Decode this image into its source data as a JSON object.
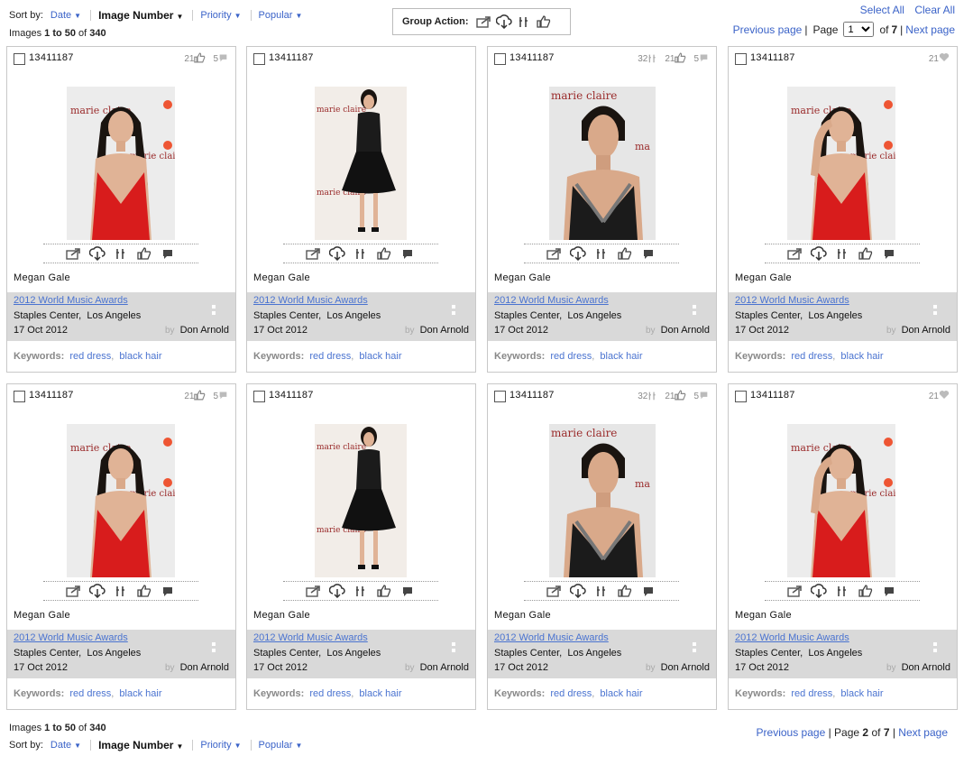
{
  "sort": {
    "label": "Sort by:",
    "options": [
      {
        "label": "Date",
        "active": false
      },
      {
        "label": "Image Number",
        "active": true
      },
      {
        "label": "Priority",
        "active": false
      },
      {
        "label": "Popular",
        "active": false
      }
    ]
  },
  "count": {
    "prefix": "Images ",
    "range": "1 to 50",
    "of": " of ",
    "total": "340"
  },
  "group_action": {
    "label": "Group Action:",
    "icons": [
      "share-icon",
      "download-icon",
      "pin-icon",
      "thumbs-up-icon"
    ]
  },
  "selection": {
    "select_all": "Select All",
    "clear_all": "Clear All"
  },
  "pager_top": {
    "prev": "Previous page",
    "page_label": "Page",
    "page_value": "1",
    "of_label": "of",
    "total_pages": "7",
    "next": "Next page"
  },
  "pager_bottom": {
    "prev": "Previous page",
    "page_label": "Page",
    "page_current": "2",
    "of_label": "of",
    "total_pages": "7",
    "next": "Next page"
  },
  "cards": [
    {
      "id": "13411187",
      "stats": [
        {
          "n": "21",
          "icon": "thumbs-up-icon"
        },
        {
          "n": "5",
          "icon": "comment-icon"
        }
      ],
      "name": "Megan Gale",
      "event": "2012 World Music Awards",
      "venue": "Staples Center,",
      "city": "Los Angeles",
      "date": "17 Oct 2012",
      "by": "by",
      "photographer": "Don Arnold",
      "keywords_label": "Keywords:",
      "keywords": [
        "red dress",
        "black hair"
      ],
      "photo": "red"
    },
    {
      "id": "13411187",
      "stats": [],
      "name": "Megan Gale",
      "event": "2012 World Music Awards",
      "venue": "Staples Center,",
      "city": "Los Angeles",
      "date": "17 Oct 2012",
      "by": "by",
      "photographer": "Don Arnold",
      "keywords_label": "Keywords:",
      "keywords": [
        "red dress",
        "black hair"
      ],
      "photo": "black-full"
    },
    {
      "id": "13411187",
      "stats": [
        {
          "n": "32",
          "icon": "pin-icon"
        },
        {
          "n": "21",
          "icon": "thumbs-up-icon"
        },
        {
          "n": "5",
          "icon": "comment-icon"
        }
      ],
      "name": "Megan Gale",
      "event": "2012 World Music Awards",
      "venue": "Staples Center,",
      "city": "Los Angeles",
      "date": "17 Oct 2012",
      "by": "by",
      "photographer": "Don Arnold",
      "keywords_label": "Keywords:",
      "keywords": [
        "red dress",
        "black hair"
      ],
      "photo": "black-close"
    },
    {
      "id": "13411187",
      "stats": [
        {
          "n": "21",
          "icon": "heart-icon"
        }
      ],
      "name": "Megan Gale",
      "event": "2012 World Music Awards",
      "venue": "Staples Center,",
      "city": "Los Angeles",
      "date": "17 Oct 2012",
      "by": "by",
      "photographer": "Don Arnold",
      "keywords_label": "Keywords:",
      "keywords": [
        "red dress",
        "black hair"
      ],
      "photo": "red-hand"
    },
    {
      "id": "13411187",
      "stats": [
        {
          "n": "21",
          "icon": "thumbs-up-icon"
        },
        {
          "n": "5",
          "icon": "comment-icon"
        }
      ],
      "name": "Megan Gale",
      "event": "2012 World Music Awards",
      "venue": "Staples Center,",
      "city": "Los Angeles",
      "date": "17 Oct 2012",
      "by": "by",
      "photographer": "Don Arnold",
      "keywords_label": "Keywords:",
      "keywords": [
        "red dress",
        "black hair"
      ],
      "photo": "red"
    },
    {
      "id": "13411187",
      "stats": [],
      "name": "Megan Gale",
      "event": "2012 World Music Awards",
      "venue": "Staples Center,",
      "city": "Los Angeles",
      "date": "17 Oct 2012",
      "by": "by",
      "photographer": "Don Arnold",
      "keywords_label": "Keywords:",
      "keywords": [
        "red dress",
        "black hair"
      ],
      "photo": "black-full"
    },
    {
      "id": "13411187",
      "stats": [
        {
          "n": "32",
          "icon": "pin-icon"
        },
        {
          "n": "21",
          "icon": "thumbs-up-icon"
        },
        {
          "n": "5",
          "icon": "comment-icon"
        }
      ],
      "name": "Megan Gale",
      "event": "2012 World Music Awards",
      "venue": "Staples Center,",
      "city": "Los Angeles",
      "date": "17 Oct 2012",
      "by": "by",
      "photographer": "Don Arnold",
      "keywords_label": "Keywords:",
      "keywords": [
        "red dress",
        "black hair"
      ],
      "photo": "black-close"
    },
    {
      "id": "13411187",
      "stats": [
        {
          "n": "21",
          "icon": "heart-icon"
        }
      ],
      "name": "Megan Gale",
      "event": "2012 World Music Awards",
      "venue": "Staples Center,",
      "city": "Los Angeles",
      "date": "17 Oct 2012",
      "by": "by",
      "photographer": "Don Arnold",
      "keywords_label": "Keywords:",
      "keywords": [
        "red dress",
        "black hair"
      ],
      "photo": "red-hand"
    }
  ],
  "card_actions": [
    "share-icon",
    "download-icon",
    "pin-icon",
    "thumbs-up-icon",
    "comment-icon"
  ],
  "colors": {
    "link": "#3b63c8",
    "info_bg": "#d9d9d9",
    "red_dress": "#d81c1c",
    "black_dress": "#1b1b1b"
  }
}
